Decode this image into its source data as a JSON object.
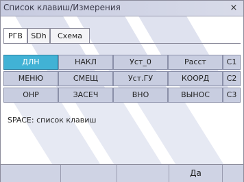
{
  "window": {
    "title": "Список клавиш/Измерения",
    "close_icon": "close-icon",
    "close_label": "×"
  },
  "tabs": [
    {
      "label": "РГВ",
      "active": true
    },
    {
      "label": "SDh",
      "active": false
    },
    {
      "label": "Схема",
      "active": false
    }
  ],
  "keys": {
    "rows": [
      [
        "ДЛН",
        "НАКЛ",
        "Уст_0",
        "Расст",
        "C1"
      ],
      [
        "МЕНЮ",
        "СМЕЩ",
        "Уст.ГУ",
        "КООРД",
        "C2"
      ],
      [
        "ОНР",
        "ЗАСЕЧ",
        "ВНО",
        "ВЫНОС",
        "C3"
      ]
    ],
    "selected": "ДЛН"
  },
  "status": {
    "text": "SPACE: список клавиш"
  },
  "softkeys": [
    "",
    "",
    "",
    "Да",
    ""
  ],
  "colors": {
    "selected_key": "#41b2d5",
    "key_background": "#c8cde0",
    "title_bar": "#c7cbe0"
  }
}
